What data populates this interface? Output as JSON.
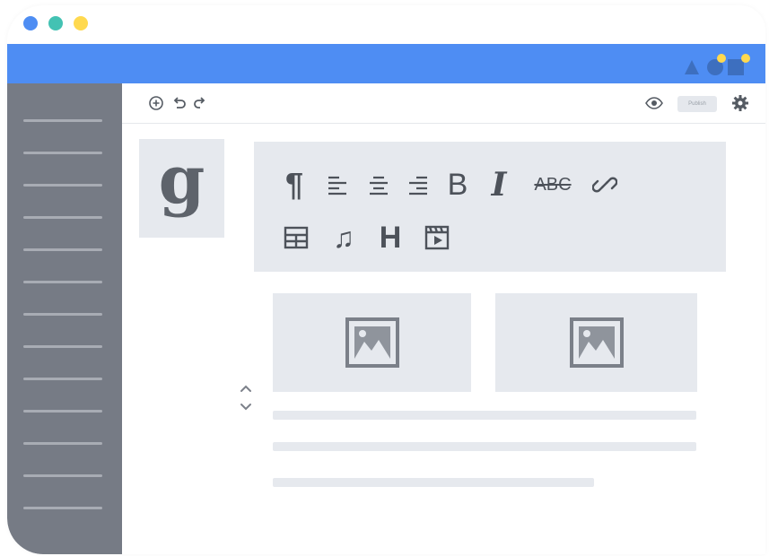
{
  "window": {
    "dots": [
      "blue",
      "teal",
      "yellow"
    ]
  },
  "colors": {
    "accent": "#4e8df3",
    "sidebar": "#767b85",
    "panel": "#e6e9ee"
  },
  "toolbar": {
    "left_icons": [
      "add-circle-icon",
      "undo-icon",
      "redo-icon"
    ],
    "publish_label": "Publish",
    "right_icons": [
      "eye-icon",
      "gear-icon"
    ]
  },
  "logo": {
    "letter": "g"
  },
  "format_panel": {
    "row1": [
      {
        "name": "paragraph-icon",
        "glyph": "¶"
      },
      {
        "name": "align-left-icon"
      },
      {
        "name": "align-center-icon"
      },
      {
        "name": "align-right-icon"
      },
      {
        "name": "bold-icon",
        "glyph": "B"
      },
      {
        "name": "italic-icon",
        "glyph": "I"
      },
      {
        "name": "strikethrough-icon",
        "glyph": "ABC"
      },
      {
        "name": "link-icon"
      }
    ],
    "row2": [
      {
        "name": "table-icon"
      },
      {
        "name": "music-icon",
        "glyph": "♫"
      },
      {
        "name": "heading-icon",
        "glyph": "H"
      },
      {
        "name": "video-icon"
      }
    ]
  },
  "image_placeholders": [
    "image-icon",
    "image-icon"
  ]
}
